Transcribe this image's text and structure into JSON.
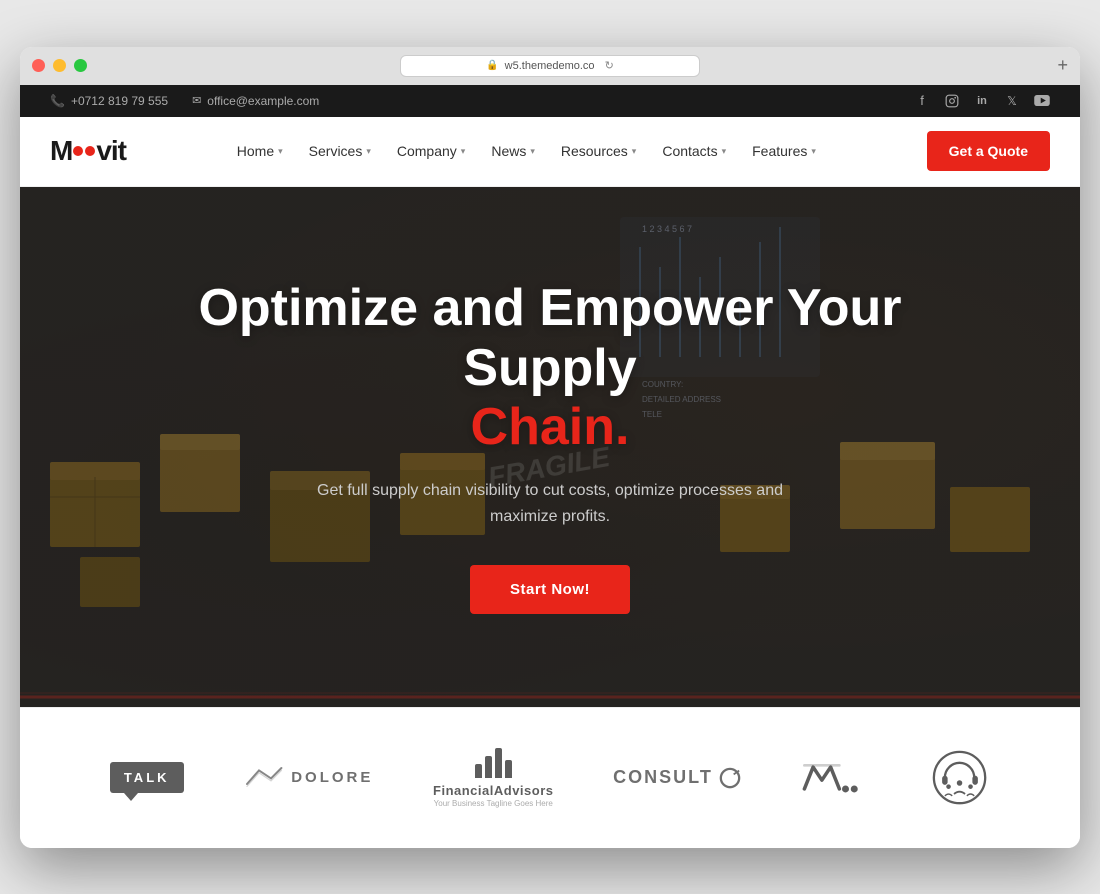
{
  "window": {
    "url": "w5.themedemo.co",
    "buttons": {
      "close": "close",
      "minimize": "minimize",
      "maximize": "maximize"
    }
  },
  "infobar": {
    "phone": "+0712 819 79 555",
    "email": "office@example.com",
    "socials": [
      "facebook",
      "instagram",
      "linkedin",
      "twitter",
      "youtube"
    ]
  },
  "navbar": {
    "logo": {
      "text_before": "M",
      "text_after": "vit"
    },
    "links": [
      {
        "label": "Home",
        "has_dropdown": true
      },
      {
        "label": "Services",
        "has_dropdown": true
      },
      {
        "label": "Company",
        "has_dropdown": true
      },
      {
        "label": "News",
        "has_dropdown": true
      },
      {
        "label": "Resources",
        "has_dropdown": true
      },
      {
        "label": "Contacts",
        "has_dropdown": true
      },
      {
        "label": "Features",
        "has_dropdown": true
      }
    ],
    "cta_label": "Get a Quote"
  },
  "hero": {
    "title_main": "Optimize and Empower Your Supply",
    "title_accent": "Chain.",
    "subtitle": "Get full supply chain visibility to cut costs, optimize processes and maximize profits.",
    "cta_label": "Start Now!"
  },
  "partners": [
    {
      "id": "talk",
      "type": "talk",
      "label": "TALK"
    },
    {
      "id": "dolore",
      "type": "dolore",
      "label": "DOLORE"
    },
    {
      "id": "financial",
      "type": "financial",
      "label": "Financial Advisors",
      "sublabel": "Your Business Tagline Goes Here"
    },
    {
      "id": "consult",
      "type": "consult",
      "label": "CONSULT"
    },
    {
      "id": "meter",
      "type": "meter",
      "label": ""
    },
    {
      "id": "headset",
      "type": "headset",
      "label": ""
    }
  ],
  "colors": {
    "accent": "#e8251a",
    "dark": "#1a1a1a",
    "light": "#ffffff"
  }
}
